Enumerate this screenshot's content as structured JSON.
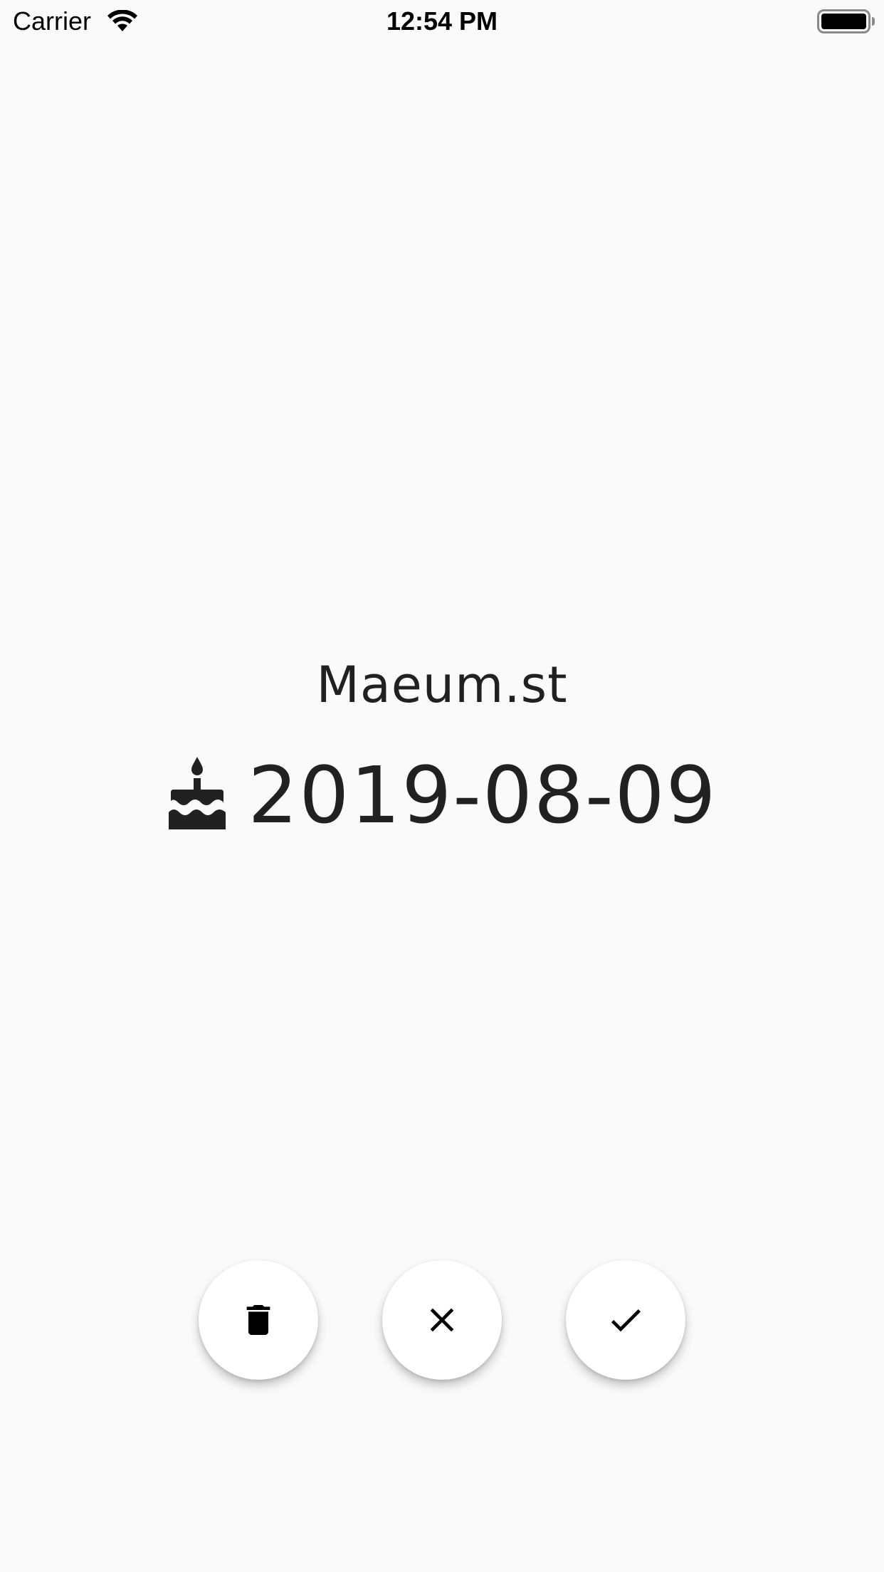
{
  "status_bar": {
    "carrier": "Carrier",
    "time": "12:54 PM",
    "wifi_icon": "wifi-icon",
    "battery_icon": "battery-full-icon"
  },
  "profile": {
    "name": "Maeum.st",
    "birthday": "2019-08-09",
    "birthday_icon": "cake-icon"
  },
  "actions": {
    "delete_icon": "trash-icon",
    "cancel_icon": "close-icon",
    "confirm_icon": "check-icon"
  },
  "colors": {
    "background": "#fafafa",
    "text": "#212121",
    "button": "#ffffff"
  }
}
